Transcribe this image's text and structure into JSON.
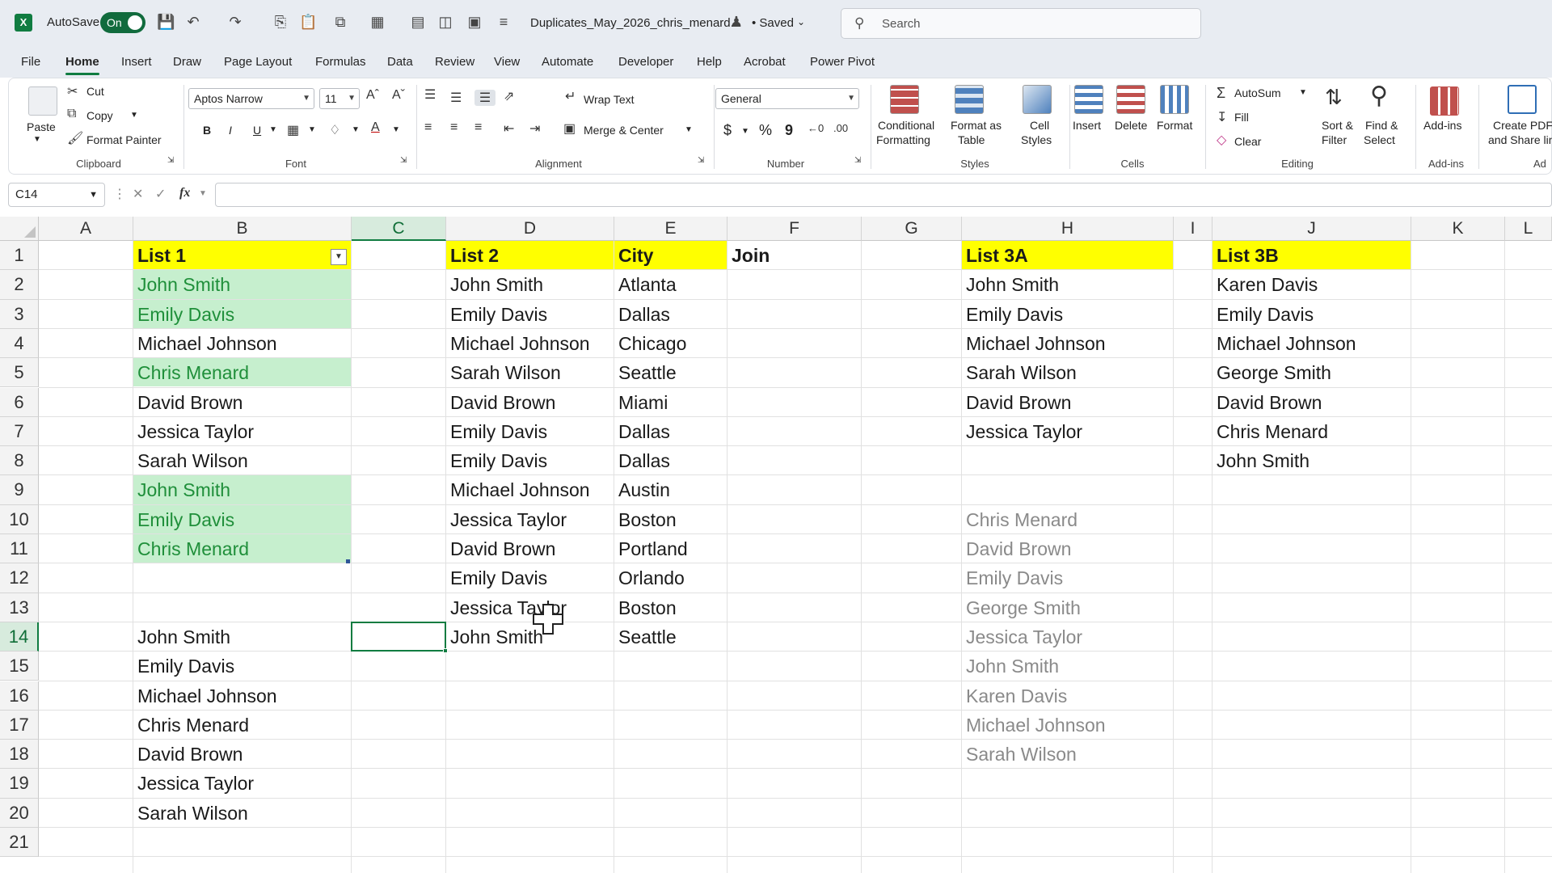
{
  "titlebar": {
    "logo_letter": "X",
    "autosave_label": "AutoSave",
    "autosave_state": "On",
    "document_title": "Duplicates_May_2026_chris_menard...",
    "saved_status": "• Saved",
    "search_placeholder": "Search"
  },
  "menu_tabs": [
    "File",
    "Home",
    "Insert",
    "Draw",
    "Page Layout",
    "Formulas",
    "Data",
    "Review",
    "View",
    "Automate",
    "Developer",
    "Help",
    "Acrobat",
    "Power Pivot"
  ],
  "active_tab": "Home",
  "ribbon": {
    "clipboard": {
      "paste": "Paste",
      "cut": "Cut",
      "copy": "Copy",
      "format_painter": "Format Painter",
      "group": "Clipboard"
    },
    "font": {
      "family": "Aptos Narrow",
      "size": "11",
      "bold": "B",
      "italic": "I",
      "underline": "U",
      "group": "Font"
    },
    "alignment": {
      "wrap_text": "Wrap Text",
      "merge_center": "Merge & Center",
      "group": "Alignment"
    },
    "number": {
      "format": "General",
      "currency": "$",
      "percent": "%",
      "comma": "9",
      "group": "Number"
    },
    "styles": {
      "conditional_1": "Conditional",
      "conditional_2": "Formatting",
      "format_table_1": "Format as",
      "format_table_2": "Table",
      "cell_styles_1": "Cell",
      "cell_styles_2": "Styles",
      "group": "Styles"
    },
    "cells": {
      "insert": "Insert",
      "delete": "Delete",
      "format": "Format",
      "group": "Cells"
    },
    "editing": {
      "autosum": "AutoSum",
      "fill": "Fill",
      "clear": "Clear",
      "sort_1": "Sort &",
      "sort_2": "Filter",
      "find_1": "Find &",
      "find_2": "Select",
      "group": "Editing"
    },
    "addins": {
      "label": "Add-ins",
      "group": "Add-ins"
    },
    "acrobat": {
      "label_1": "Create PDF",
      "label_2": "and Share lin",
      "group": "Ad"
    }
  },
  "formula_bar": {
    "name_box": "C14",
    "fx": "fx",
    "formula": ""
  },
  "grid": {
    "columns": [
      "A",
      "B",
      "C",
      "D",
      "E",
      "F",
      "G",
      "H",
      "I",
      "J",
      "K",
      "L"
    ],
    "selected_column": "C",
    "rows": [
      "1",
      "2",
      "3",
      "4",
      "5",
      "6",
      "7",
      "8",
      "9",
      "10",
      "11",
      "12",
      "13",
      "14",
      "15",
      "16",
      "17",
      "18",
      "19",
      "20",
      "21"
    ],
    "selected_row": "14",
    "active_cell": "C14",
    "list1": {
      "header": "List 1",
      "values": [
        "John Smith",
        "Emily Davis",
        "Michael Johnson",
        "Chris Menard",
        "David Brown",
        "Jessica Taylor",
        "Sarah Wilson",
        "John Smith",
        "Emily Davis",
        "Chris Menard"
      ],
      "highlighted_duplicates": [
        true,
        true,
        false,
        true,
        false,
        false,
        false,
        true,
        true,
        true
      ],
      "highlight_fill": "#c6efce",
      "highlight_text": "#1f8f3a"
    },
    "list1_unique": [
      "John Smith",
      "Emily Davis",
      "Michael Johnson",
      "Chris Menard",
      "David Brown",
      "Jessica Taylor",
      "Sarah Wilson"
    ],
    "list2": {
      "header": "List 2",
      "city_header": "City",
      "names": [
        "John Smith",
        "Emily Davis",
        "Michael Johnson",
        "Sarah Wilson",
        "David Brown",
        "Emily Davis",
        "Emily Davis",
        "Michael Johnson",
        "Jessica Taylor",
        "David Brown",
        "Emily Davis",
        "Jessica Taylor",
        "John Smith"
      ],
      "cities": [
        "Atlanta",
        "Dallas",
        "Chicago",
        "Seattle",
        "Miami",
        "Dallas",
        "Dallas",
        "Austin",
        "Boston",
        "Portland",
        "Orlando",
        "Boston",
        "Seattle"
      ]
    },
    "join_header": "Join",
    "list3a": {
      "header": "List 3A",
      "values": [
        "John Smith",
        "Emily Davis",
        "Michael Johnson",
        "Sarah Wilson",
        "David Brown",
        "Jessica Taylor"
      ],
      "faded_values": [
        "Chris Menard",
        "David Brown",
        "Emily Davis",
        "George Smith",
        "Jessica Taylor",
        "John Smith",
        "Karen Davis",
        "Michael Johnson",
        "Sarah Wilson"
      ]
    },
    "list3b": {
      "header": "List 3B",
      "values": [
        "Karen Davis",
        "Emily Davis",
        "Michael Johnson",
        "George Smith",
        "David Brown",
        "Chris Menard",
        "John Smith"
      ]
    },
    "header_fill": "#ffff00"
  }
}
